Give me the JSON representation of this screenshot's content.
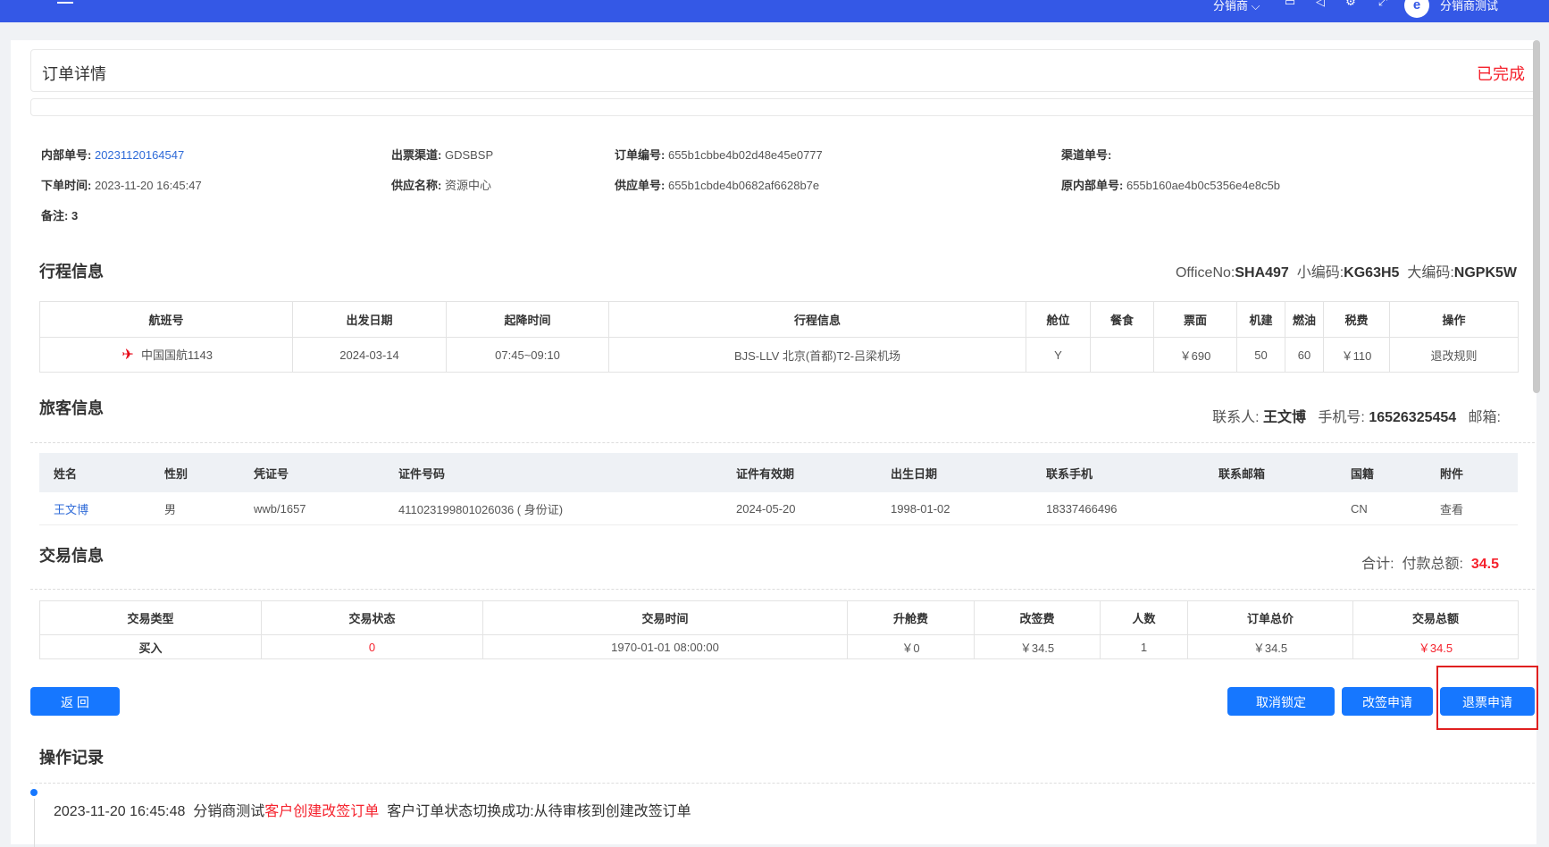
{
  "topbar": {
    "role": "分销商 ⌵",
    "username": "分销商测试",
    "icons": [
      "desktop-icon",
      "notification-icon",
      "settings-icon",
      "fullscreen-icon"
    ]
  },
  "header": {
    "title": "订单详情",
    "status": "已完成"
  },
  "order_info": {
    "internal_no_label": "内部单号:",
    "internal_no": "20231120164547",
    "order_time_label": "下单时间:",
    "order_time": "2023-11-20 16:45:47",
    "remark_label": "备注:",
    "remark": "3",
    "channel_label": "出票渠道:",
    "channel": "GDSBSP",
    "supplier_name_label": "供应名称:",
    "supplier_name": "资源中心",
    "order_no_label": "订单编号:",
    "order_no": "655b1cbbe4b02d48e45e0777",
    "supplier_no_label": "供应单号:",
    "supplier_no": "655b1cbde4b0682af6628b7e",
    "channel_no_label": "渠道单号:",
    "channel_no": "",
    "orig_internal_no_label": "原内部单号:",
    "orig_internal_no": "655b160ae4b0c5356e4e8c5b"
  },
  "itinerary": {
    "title": "行程信息",
    "office_label": "OfficeNo:",
    "office": "SHA497",
    "small_code_label": "小编码:",
    "small_code": "KG63H5",
    "big_code_label": "大编码:",
    "big_code": "NGPK5W",
    "headers": [
      "航班号",
      "出发日期",
      "起降时间",
      "行程信息",
      "舱位",
      "餐食",
      "票面",
      "机建",
      "燃油",
      "税费",
      "操作"
    ],
    "row": {
      "flight": "中国国航1143",
      "date": "2024-03-14",
      "time": "07:45~09:10",
      "route": "BJS-LLV   北京(首都)T2-吕梁机场",
      "cabin": "Y",
      "meal": "",
      "fare": "￥690",
      "airport_fee": "50",
      "fuel": "60",
      "tax": "￥110",
      "action": "退改规则"
    }
  },
  "passenger": {
    "title": "旅客信息",
    "contact_label": "联系人:",
    "contact": "王文博",
    "phone_label": "手机号:",
    "phone": "16526325454",
    "email_label": "邮箱:",
    "headers": [
      "姓名",
      "性别",
      "凭证号",
      "证件号码",
      "证件有效期",
      "出生日期",
      "联系手机",
      "联系邮箱",
      "国籍",
      "附件"
    ],
    "row": {
      "name": "王文博",
      "gender": "男",
      "voucher": "wwb/1657",
      "id_no": "411023199801026036 ( 身份证)",
      "id_expiry": "2024-05-20",
      "birth": "1998-01-02",
      "mobile": "18337466496",
      "email": "",
      "nationality": "CN",
      "attachment": "查看"
    }
  },
  "transaction": {
    "title": "交易信息",
    "total_label": "合计:",
    "paid_label": "付款总额:",
    "paid": "34.5",
    "headers": [
      "交易类型",
      "交易状态",
      "交易时间",
      "升舱费",
      "改签费",
      "人数",
      "订单总价",
      "交易总额"
    ],
    "row": {
      "type": "买入",
      "status": "0",
      "time": "1970-01-01 08:00:00",
      "upgrade_fee": "￥0",
      "change_fee": "￥34.5",
      "count": "1",
      "order_total": "￥34.5",
      "trade_total": "￥34.5"
    }
  },
  "buttons": {
    "back": "返 回",
    "cancel_lock": "取消锁定",
    "change_apply": "改签申请",
    "refund_apply": "退票申请"
  },
  "log": {
    "title": "操作记录",
    "time": "2023-11-20 16:45:48",
    "actor": "分销商测试",
    "action": "客户创建改签订单",
    "message": "客户订单状态切换成功:从待审核到创建改签订单"
  }
}
